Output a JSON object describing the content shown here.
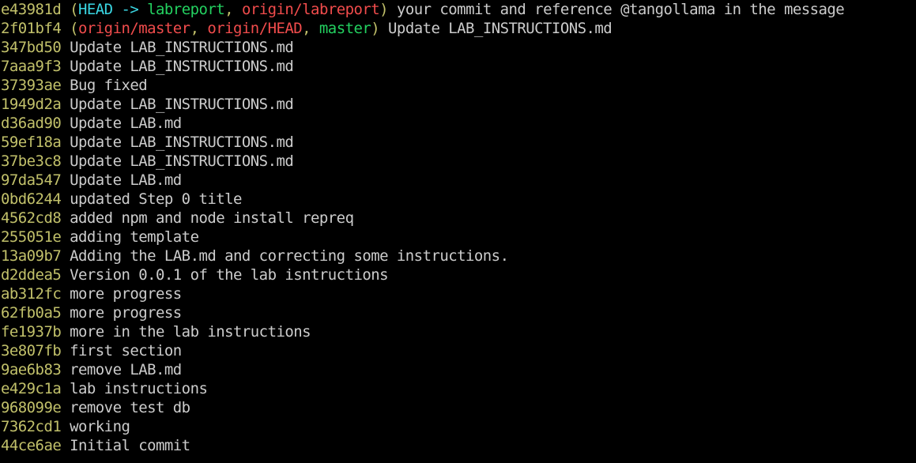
{
  "colors": {
    "background": "#000000",
    "hash": "#c1c06a",
    "head": "#3ad7e3",
    "local_branch": "#23d160",
    "remote_branch": "#f14c4c",
    "message": "#cccccc"
  },
  "log": [
    {
      "hash": "e43981d",
      "refs": [
        {
          "text": "HEAD -> ",
          "kind": "head"
        },
        {
          "text": "labreport",
          "kind": "local"
        },
        {
          "text": ", ",
          "kind": "sep"
        },
        {
          "text": "origin/labreport",
          "kind": "remote"
        }
      ],
      "message": "your commit and reference @tangollama in the message"
    },
    {
      "hash": "2f01bf4",
      "refs": [
        {
          "text": "origin/master",
          "kind": "remote"
        },
        {
          "text": ", ",
          "kind": "sep"
        },
        {
          "text": "origin/HEAD",
          "kind": "remote"
        },
        {
          "text": ", ",
          "kind": "sep"
        },
        {
          "text": "master",
          "kind": "local"
        }
      ],
      "message": "Update LAB_INSTRUCTIONS.md"
    },
    {
      "hash": "347bd50",
      "refs": [],
      "message": "Update LAB_INSTRUCTIONS.md"
    },
    {
      "hash": "7aaa9f3",
      "refs": [],
      "message": "Update LAB_INSTRUCTIONS.md"
    },
    {
      "hash": "37393ae",
      "refs": [],
      "message": "Bug fixed"
    },
    {
      "hash": "1949d2a",
      "refs": [],
      "message": "Update LAB_INSTRUCTIONS.md"
    },
    {
      "hash": "d36ad90",
      "refs": [],
      "message": "Update LAB.md"
    },
    {
      "hash": "59ef18a",
      "refs": [],
      "message": "Update LAB_INSTRUCTIONS.md"
    },
    {
      "hash": "37be3c8",
      "refs": [],
      "message": "Update LAB_INSTRUCTIONS.md"
    },
    {
      "hash": "97da547",
      "refs": [],
      "message": "Update LAB.md"
    },
    {
      "hash": "0bd6244",
      "refs": [],
      "message": "updated Step 0 title"
    },
    {
      "hash": "4562cd8",
      "refs": [],
      "message": "added npm and node install repreq"
    },
    {
      "hash": "255051e",
      "refs": [],
      "message": "adding template"
    },
    {
      "hash": "13a09b7",
      "refs": [],
      "message": "Adding the LAB.md and correcting some instructions."
    },
    {
      "hash": "d2ddea5",
      "refs": [],
      "message": "Version 0.0.1 of the lab isntructions"
    },
    {
      "hash": "ab312fc",
      "refs": [],
      "message": "more progress"
    },
    {
      "hash": "62fb0a5",
      "refs": [],
      "message": "more progress"
    },
    {
      "hash": "fe1937b",
      "refs": [],
      "message": "more in the lab instructions"
    },
    {
      "hash": "3e807fb",
      "refs": [],
      "message": "first section"
    },
    {
      "hash": "9ae6b83",
      "refs": [],
      "message": "remove LAB.md"
    },
    {
      "hash": "e429c1a",
      "refs": [],
      "message": "lab instructions"
    },
    {
      "hash": "968099e",
      "refs": [],
      "message": "remove test db"
    },
    {
      "hash": "7362cd1",
      "refs": [],
      "message": "working"
    },
    {
      "hash": "44ce6ae",
      "refs": [],
      "message": "Initial commit"
    }
  ]
}
